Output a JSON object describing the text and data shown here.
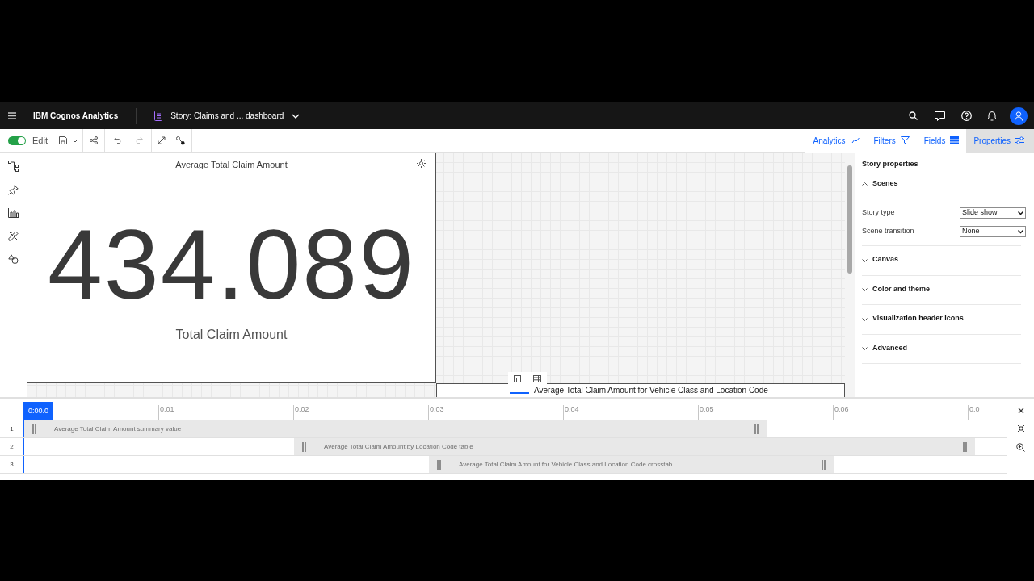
{
  "app_bar": {
    "product": "IBM Cognos Analytics",
    "document": "Story: Claims and ... dashboard"
  },
  "toolbar": {
    "edit_label": "Edit",
    "edit_on": true
  },
  "panel_tabs": [
    {
      "label": "Analytics",
      "selected": false
    },
    {
      "label": "Filters",
      "selected": false
    },
    {
      "label": "Fields",
      "selected": false
    },
    {
      "label": "Properties",
      "selected": true
    }
  ],
  "summary_widget": {
    "title": "Average Total Claim Amount",
    "value": "434.089",
    "caption": "Total Claim Amount"
  },
  "second_widget": {
    "title": "Average Total Claim Amount for Vehicle Class and Location Code"
  },
  "properties": {
    "title": "Story properties",
    "sections": [
      {
        "label": "Scenes",
        "expanded": true,
        "fields": [
          {
            "label": "Story type",
            "value": "Slide show"
          },
          {
            "label": "Scene transition",
            "value": "None"
          }
        ]
      },
      {
        "label": "Canvas",
        "expanded": false
      },
      {
        "label": "Color and theme",
        "expanded": false
      },
      {
        "label": "Visualization header icons",
        "expanded": false
      },
      {
        "label": "Advanced",
        "expanded": false
      }
    ]
  },
  "timeline": {
    "playhead": "0:00.0",
    "ticks": [
      "0:01",
      "0:02",
      "0:03",
      "0:04",
      "0:05",
      "0:06",
      "0:0"
    ],
    "tracks": [
      {
        "number": "1",
        "label": "Average Total Claim Amount summary value"
      },
      {
        "number": "2",
        "label": "Average Total Claim Amount by Location Code table"
      },
      {
        "number": "3",
        "label": "Average Total Claim Amount for Vehicle Class and Location Code crosstab"
      }
    ]
  }
}
